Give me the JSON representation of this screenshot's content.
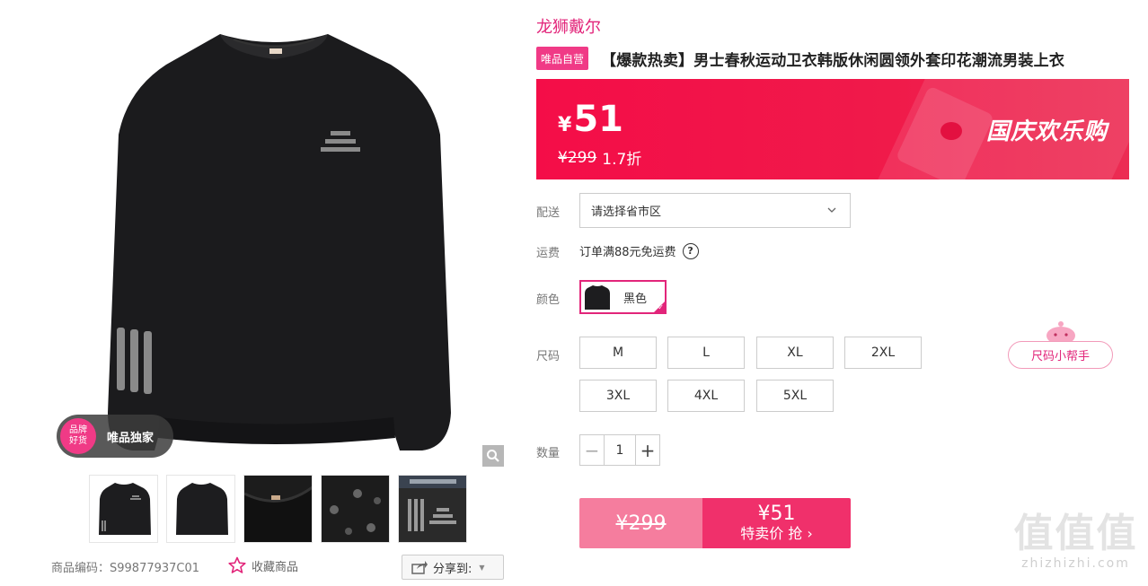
{
  "gallery": {
    "exclusive_badge_circle": "品牌\n好货",
    "exclusive_badge_text": "唯品独家",
    "thumbnails": [
      "front",
      "back",
      "collar",
      "cuff-print",
      "design-detail"
    ]
  },
  "meta": {
    "product_code": "商品编码：S99877937C01",
    "favorite_label": "收藏商品",
    "share_label": "分享到:"
  },
  "product": {
    "brand": "龙狮戴尔",
    "self_operated_badge": "唯品自营",
    "title": "【爆款热卖】男士春秋运动卫衣韩版休闲圆领外套印花潮流男装上衣"
  },
  "price": {
    "currency_symbol": "¥",
    "current": "51",
    "original": "¥299",
    "discount": "1.7折",
    "campaign": "国庆欢乐购",
    "banner_color": "#f40d48"
  },
  "delivery": {
    "label": "配送",
    "placeholder": "请选择省市区"
  },
  "shipping": {
    "label": "运费",
    "text": "订单满88元免运费",
    "help_icon": "?"
  },
  "color": {
    "label": "颜色",
    "selected": "黑色"
  },
  "size": {
    "label": "尺码",
    "options": [
      "M",
      "L",
      "XL",
      "2XL",
      "3XL",
      "4XL",
      "5XL"
    ],
    "helper": "尺码小帮手"
  },
  "quantity": {
    "label": "数量",
    "value": "1",
    "minus": "−",
    "plus": "+"
  },
  "buy": {
    "original": "¥299",
    "price": "¥51",
    "action": "特卖价 抢 ›"
  },
  "watermark": {
    "big": "值值值",
    "small": "zhizhizhi.com"
  }
}
